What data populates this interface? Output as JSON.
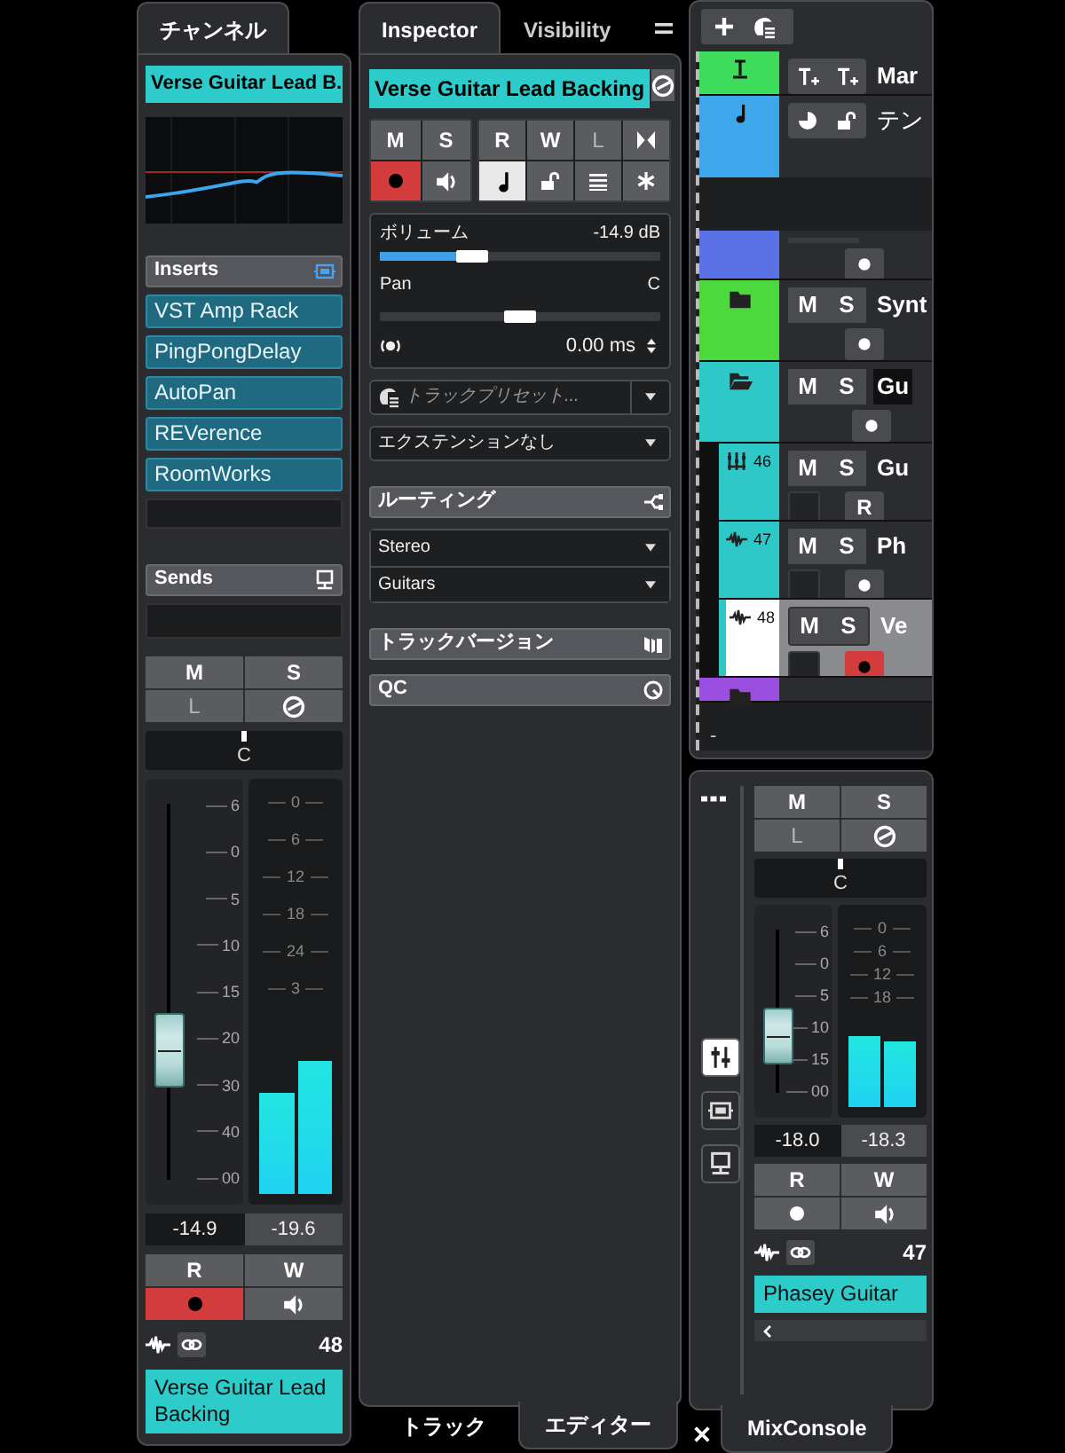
{
  "channel": {
    "tab": {
      "label": "チャンネル",
      "selected": true
    },
    "track_name": "Verse Guitar Lead B.",
    "inserts": {
      "title": "Inserts",
      "slots": [
        "VST Amp Rack",
        "PingPongDelay",
        "AutoPan",
        "REVerence",
        "RoomWorks"
      ]
    },
    "sends": {
      "title": "Sends"
    },
    "strip": {
      "mute": "M",
      "solo": "S",
      "listen": {
        "label": "L",
        "disabled": true
      },
      "pan": "C",
      "fader": {
        "scale": [
          "6",
          "0",
          "5",
          "10",
          "15",
          "20",
          "30",
          "40",
          "00"
        ],
        "level": 0.35
      },
      "meter": {
        "scale": [
          "0",
          "6",
          "12",
          "18",
          "24",
          "3"
        ],
        "bars": [
          {
            "level": 0.25
          },
          {
            "level": 0.33
          }
        ]
      },
      "volume": "-14.9",
      "peak": "-19.6",
      "read": "R",
      "write": "W",
      "record": {
        "on": true
      },
      "number": "48",
      "name": "Verse Guitar Lead Backing"
    }
  },
  "inspector": {
    "tabs": [
      {
        "label": "Inspector",
        "selected": true
      },
      {
        "label": "Visibility",
        "selected": false
      }
    ],
    "track_name": "Verse Guitar Lead Backing",
    "buttons": {
      "mute": "M",
      "solo": "S",
      "read": "R",
      "write": "W",
      "listen": {
        "label": "L",
        "disabled": true
      },
      "record": {
        "on": true
      },
      "musical_time": {
        "on": true
      }
    },
    "volume": {
      "label": "ボリューム",
      "value": "-14.9 dB",
      "level": 0.33
    },
    "pan": {
      "label": "Pan",
      "value": "C",
      "level": 0.5
    },
    "delay": {
      "value": "0.00 ms"
    },
    "preset": {
      "placeholder": "トラックプリセット..."
    },
    "extension": {
      "value": "エクステンションなし"
    },
    "routing": {
      "title": "ルーティング",
      "rows": [
        "Stereo",
        "Guitars"
      ]
    },
    "sections": [
      {
        "kind": "versions",
        "title": "トラックバージョン"
      },
      {
        "kind": "qc",
        "title": "QC"
      }
    ],
    "bottom_tabs": [
      {
        "label": "トラック",
        "selected": false
      },
      {
        "label": "エディター",
        "selected": true
      }
    ]
  },
  "track_list": {
    "tracks": [
      {
        "kind": "marker",
        "color": "#3ddc5a",
        "name": "Mar",
        "selected": false
      },
      {
        "kind": "tempo",
        "color": "#3ea6ea",
        "name": "テン",
        "selected": false
      },
      {
        "kind": "partial",
        "color": "#5b72e6",
        "selected": false,
        "record": false
      },
      {
        "kind": "folder",
        "color": "#4cd93e",
        "open": false,
        "mute": "M",
        "solo": "S",
        "name": "Synt",
        "selected": false,
        "record": false
      },
      {
        "kind": "folder",
        "color": "#2ec8c8",
        "open": true,
        "mute": "M",
        "solo": "S",
        "name": "Gu",
        "selected": false,
        "record": false,
        "children": [
          {
            "kind": "instrument",
            "color": "#2ec8c8",
            "number": "46",
            "mute": "M",
            "solo": "S",
            "name": "Gu",
            "selected": false,
            "read": "R"
          },
          {
            "kind": "audio",
            "color": "#2ec8c8",
            "number": "47",
            "mute": "M",
            "solo": "S",
            "name": "Ph",
            "selected": false,
            "record": false
          },
          {
            "kind": "audio",
            "color": "#2ec8c8",
            "number": "48",
            "mute": "M",
            "solo": "S",
            "name": "Ve",
            "selected": true,
            "record": true
          }
        ]
      },
      {
        "kind": "folder_cut",
        "color": "#9a4fe0",
        "selected": false
      }
    ],
    "footer": "-"
  },
  "mixconsole": {
    "side_tools": [
      {
        "kind": "faders",
        "selected": true
      },
      {
        "kind": "inserts",
        "selected": false
      },
      {
        "kind": "sends",
        "selected": false
      }
    ],
    "strip": {
      "mute": "M",
      "solo": "S",
      "listen": {
        "label": "L",
        "disabled": true
      },
      "pan": "C",
      "fader": {
        "scale": [
          "6",
          "0",
          "5",
          "10",
          "15",
          "00"
        ],
        "level": 0.36
      },
      "meter": {
        "scale": [
          "0",
          "6",
          "12",
          "18"
        ],
        "bars": [
          {
            "level": 0.37
          },
          {
            "level": 0.34
          }
        ]
      },
      "volume": "-18.0",
      "peak": "-18.3",
      "read": "R",
      "write": "W",
      "record": {
        "on": false
      },
      "number": "47",
      "name": "Phasey Guitar"
    },
    "tabs": [
      {
        "label": "MixConsole",
        "selected": true
      }
    ]
  }
}
